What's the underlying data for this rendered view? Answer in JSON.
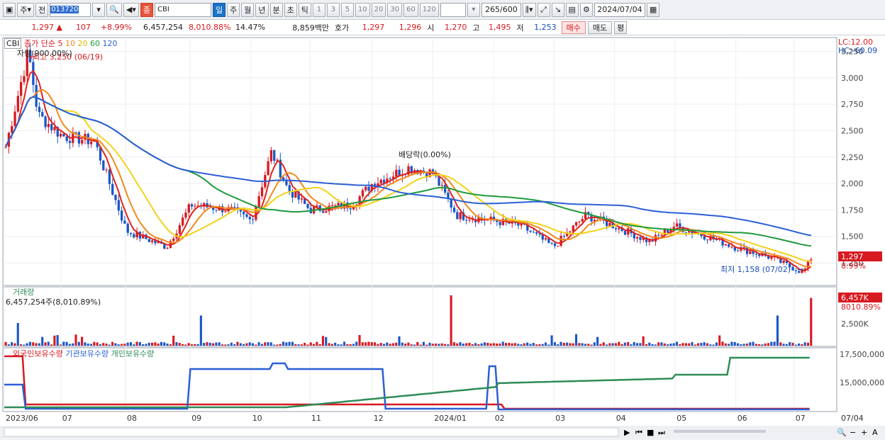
{
  "toolbar": {
    "market_prefix": "주",
    "prev_label": "전",
    "stock_code": "013720",
    "stock_badge": "종",
    "stock_name": "CBI",
    "period_tabs": [
      "일",
      "주",
      "월",
      "년",
      "분",
      "초",
      "틱"
    ],
    "active_period": "일",
    "minute_options": [
      "1",
      "3",
      "5",
      "10",
      "20",
      "30",
      "60",
      "120"
    ],
    "bar_count": "265",
    "bar_total": "/600",
    "date": "2024/07/04"
  },
  "quote": {
    "price": "1,297",
    "change_arrow": "▲",
    "change": "107",
    "change_pct": "+8.99%",
    "volume": "6,457,254",
    "volume_ratio": "8,010.88%",
    "turnover": "14.47%",
    "amount": "8,859백만",
    "bid_label": "호가",
    "ask_price": "1,297",
    "bid_price": "1,296",
    "open_label": "시",
    "open": "1,270",
    "high_label": "고",
    "high": "1,495",
    "low_label": "저",
    "low": "1,253",
    "buy_label": "매수",
    "sell_label": "매도",
    "eval_label": "평"
  },
  "price_panel": {
    "ticker_label": "CBI",
    "ma_legend_prefix": "종가 단순",
    "ma_periods": [
      "5",
      "10",
      "20",
      "60",
      "120"
    ],
    "ma_colors": [
      "#e0221b",
      "#f08a1c",
      "#f2d21a",
      "#1e9a3c",
      "#2b5fd6"
    ],
    "sub_label": "자랑(900.00%)",
    "lc_label": "LC:12.00",
    "hc_label": "HC:-60.09",
    "high_annotation": "최고 3,250 (06/19)",
    "low_annotation": "최저 1,158 (07/02)",
    "dividend_annotation": "배당락(0.00%)",
    "current_price_tag": "1,297",
    "current_pct_tag": "8.99%",
    "y_ticks": [
      "3,250",
      "3,000",
      "2,750",
      "2,500",
      "2,250",
      "2,000",
      "1,750",
      "1,500",
      "1,250"
    ]
  },
  "volume_panel": {
    "title": "거래량",
    "value_label": "6,457,254주(8,010.89%)",
    "tag_value": "6,457K",
    "tag_pct": "8010.89%",
    "y_ticks": [
      "2,500K"
    ]
  },
  "holding_panel": {
    "legend": [
      "외국인보유수량",
      "기관보유수량",
      "개인보유수량"
    ],
    "legend_colors": [
      "#d71920",
      "#2b5fd6",
      "#2e8b57"
    ],
    "y_ticks": [
      "17,500,000",
      "15,000,000"
    ]
  },
  "x_axis": {
    "labels": [
      "2023/06",
      "07",
      "08",
      "09",
      "10",
      "11",
      "12",
      "2024/01",
      "02",
      "03",
      "04",
      "05",
      "06",
      "07"
    ],
    "right_label": "07/04"
  },
  "chart_data": {
    "type": "candlestick",
    "x_range": [
      "2023/06",
      "2024/07/04"
    ],
    "price_ylim": [
      1158,
      3250
    ],
    "close_trend": [
      {
        "x": "2023/06",
        "y": 2350
      },
      {
        "x": "2023/06/19",
        "y": 3250
      },
      {
        "x": "2023/06/25",
        "y": 2650
      },
      {
        "x": "2023/07",
        "y": 2450
      },
      {
        "x": "2023/07/15",
        "y": 2400
      },
      {
        "x": "2023/08",
        "y": 1550
      },
      {
        "x": "2023/08/20",
        "y": 1400
      },
      {
        "x": "2023/09",
        "y": 1800
      },
      {
        "x": "2023/09/20",
        "y": 1750
      },
      {
        "x": "2023/10",
        "y": 1650
      },
      {
        "x": "2023/10/10",
        "y": 2300
      },
      {
        "x": "2023/10/20",
        "y": 1950
      },
      {
        "x": "2023/11",
        "y": 1750
      },
      {
        "x": "2023/11/20",
        "y": 1800
      },
      {
        "x": "2023/12",
        "y": 2000
      },
      {
        "x": "2023/12/20",
        "y": 2150
      },
      {
        "x": "2024/01",
        "y": 2100
      },
      {
        "x": "2024/01/20",
        "y": 1700
      },
      {
        "x": "2024/02",
        "y": 1650
      },
      {
        "x": "2024/02/20",
        "y": 1600
      },
      {
        "x": "2024/03",
        "y": 1400
      },
      {
        "x": "2024/03/15",
        "y": 1700
      },
      {
        "x": "2024/04",
        "y": 1600
      },
      {
        "x": "2024/04/20",
        "y": 1450
      },
      {
        "x": "2024/05",
        "y": 1600
      },
      {
        "x": "2024/05/20",
        "y": 1500
      },
      {
        "x": "2024/06",
        "y": 1400
      },
      {
        "x": "2024/06/20",
        "y": 1300
      },
      {
        "x": "2024/07/02",
        "y": 1158
      },
      {
        "x": "2024/07/04",
        "y": 1297
      }
    ],
    "volume_peak": {
      "x": "2024/07/04",
      "value": 6457254
    }
  }
}
